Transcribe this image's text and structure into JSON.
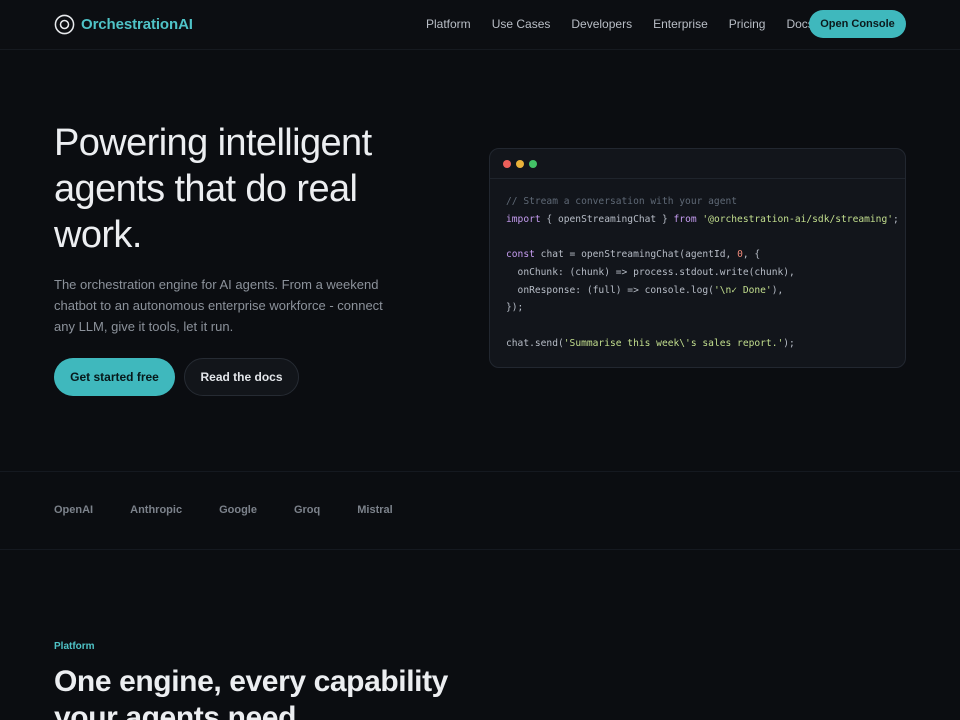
{
  "nav": {
    "brand": {
      "name": "Orchestration",
      "suffix": "AI"
    },
    "links": [
      "Platform",
      "Use Cases",
      "Developers",
      "Enterprise",
      "Pricing",
      "Docs"
    ],
    "cta": "Open Console"
  },
  "hero": {
    "title_lines": [
      "Powering intelligent",
      "agents that do real",
      "work."
    ],
    "subtitle": "The orchestration engine for AI agents. From a weekend chatbot to an autonomous enterprise workforce - connect any LLM, give it tools, let it run.",
    "primary_button": "Get started free",
    "secondary_button": "Read the docs"
  },
  "code": {
    "comment": "// Stream a conversation with your agent",
    "import_kw": "import",
    "import_mid": " { openStreamingChat } ",
    "from_kw": "from",
    "import_path": "'@orchestration-ai/sdk/streaming'",
    "semi": ";",
    "const_kw": "const",
    "const_mid": " chat = openStreamingChat(agentId, ",
    "zero": "0",
    "const_end": ", {",
    "on_chunk": "  onChunk: (chunk) => process.stdout.write(chunk),",
    "on_response_start": "  onResponse: (full) => console.log(",
    "done_str": "'\\n✓ Done'",
    "on_response_end": "),",
    "close": "});",
    "send_start": "chat.send(",
    "send_str": "'Summarise this week\\'s sales report.'",
    "send_end": ");"
  },
  "providers": [
    "OpenAI",
    "Anthropic",
    "Google",
    "Groq",
    "Mistral"
  ],
  "platform": {
    "eyebrow": "Platform",
    "title_lines": [
      "One engine, every capability",
      "your agents need"
    ]
  },
  "colors": {
    "accent": "#3fb8bd",
    "background": "#0b0d11"
  }
}
